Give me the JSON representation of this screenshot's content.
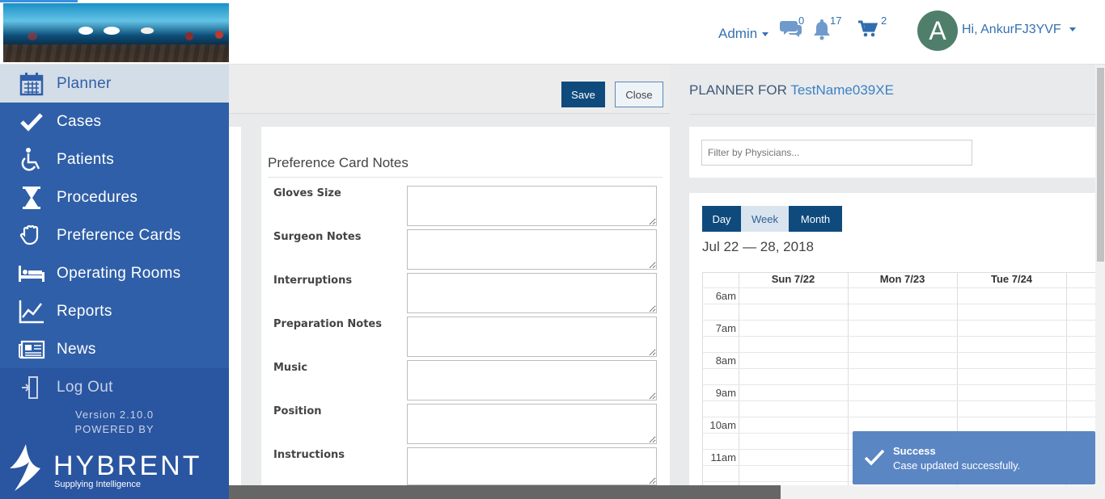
{
  "header": {
    "admin_label": "Admin",
    "messages_count": "0",
    "notifications_count": "17",
    "cart_count": "2",
    "avatar_initial": "A",
    "greeting": "Hi, AnkurFJ3YVF"
  },
  "sidebar": {
    "items": [
      {
        "label": "Planner",
        "icon": "calendar-icon"
      },
      {
        "label": "Cases",
        "icon": "check-icon"
      },
      {
        "label": "Patients",
        "icon": "wheelchair-icon"
      },
      {
        "label": "Procedures",
        "icon": "hourglass-icon"
      },
      {
        "label": "Preference Cards",
        "icon": "glove-icon"
      },
      {
        "label": "Operating Rooms",
        "icon": "bed-icon"
      },
      {
        "label": "Reports",
        "icon": "chart-icon"
      },
      {
        "label": "News",
        "icon": "newspaper-icon"
      },
      {
        "label": "Log Out",
        "icon": "logout-icon"
      }
    ],
    "version": "Version 2.10.0",
    "powered_by": "POWERED BY",
    "brand": "HYBRENT",
    "tagline": "Supplying Intelligence"
  },
  "toolbar": {
    "save_label": "Save",
    "close_label": "Close"
  },
  "preference_card": {
    "title": "Preference Card Notes",
    "fields": [
      {
        "label": "Gloves Size",
        "value": ""
      },
      {
        "label": "Surgeon Notes",
        "value": ""
      },
      {
        "label": "Interruptions",
        "value": ""
      },
      {
        "label": "Preparation Notes",
        "value": ""
      },
      {
        "label": "Music",
        "value": ""
      },
      {
        "label": "Position",
        "value": ""
      },
      {
        "label": "Instructions",
        "value": ""
      }
    ]
  },
  "planner": {
    "title_prefix": "PLANNER FOR",
    "name": "TestName039XE",
    "filter_placeholder": "Filter by Physicians...",
    "views": [
      "Day",
      "Week",
      "Month"
    ],
    "active_view": "Week",
    "date_range": "Jul 22 — 28, 2018",
    "columns": [
      "Sun 7/22",
      "Mon 7/23",
      "Tue 7/24"
    ],
    "times": [
      "6am",
      "7am",
      "8am",
      "9am",
      "10am",
      "11am"
    ]
  },
  "toast": {
    "title": "Success",
    "message": "Case updated successfully."
  },
  "colors": {
    "sidebar": "#2f5fa8",
    "primary_button": "#0f4a7d",
    "link": "#3572b0",
    "toast": "#5b86c4"
  }
}
